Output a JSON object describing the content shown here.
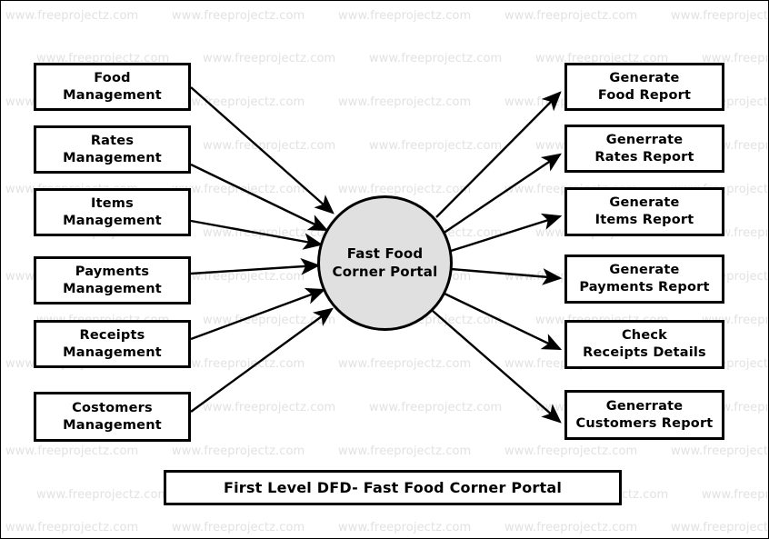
{
  "diagram": {
    "title": "First Level DFD- Fast Food Corner Portal",
    "process": {
      "name": "Fast Food Corner Portal",
      "line1": "Fast Food",
      "line2": "Corner Portal",
      "fill_color": "#e0e0e0",
      "border_color": "#000000"
    },
    "inputs": [
      {
        "line1": "Food",
        "line2": "Management"
      },
      {
        "line1": "Rates",
        "line2": "Management"
      },
      {
        "line1": "Items",
        "line2": "Management"
      },
      {
        "line1": "Payments",
        "line2": "Management"
      },
      {
        "line1": "Receipts",
        "line2": "Management"
      },
      {
        "line1": "Costomers",
        "line2": "Management"
      }
    ],
    "outputs": [
      {
        "line1": "Generate",
        "line2": "Food Report"
      },
      {
        "line1": "Generrate",
        "line2": "Rates Report"
      },
      {
        "line1": "Generate",
        "line2": "Items Report"
      },
      {
        "line1": "Generate",
        "line2": "Payments Report"
      },
      {
        "line1": "Check",
        "line2": "Receipts Details"
      },
      {
        "line1": "Generrate",
        "line2": "Customers Report"
      }
    ]
  },
  "watermark": {
    "text": "www.freeprojectz.com",
    "color": "#e2e2e2"
  }
}
